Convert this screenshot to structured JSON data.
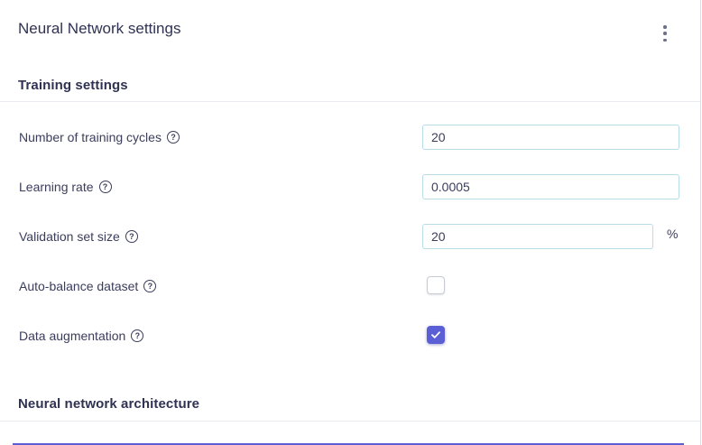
{
  "panel": {
    "title": "Neural Network settings",
    "menu_icon": "vertical-ellipsis-icon"
  },
  "training_settings": {
    "heading": "Training settings",
    "cycles": {
      "label": "Number of training cycles",
      "value": "20"
    },
    "learning_rate": {
      "label": "Learning rate",
      "value": "0.0005"
    },
    "validation": {
      "label": "Validation set size",
      "value": "20",
      "unit": "%"
    },
    "auto_balance": {
      "label": "Auto-balance dataset",
      "checked": false
    },
    "augmentation": {
      "label": "Data augmentation",
      "checked": true
    },
    "help_icon": "?"
  },
  "architecture": {
    "heading": "Neural network architecture"
  },
  "colors": {
    "accent": "#5b5fd6",
    "input_border": "#b8dde6",
    "text": "#3a3d5c"
  }
}
